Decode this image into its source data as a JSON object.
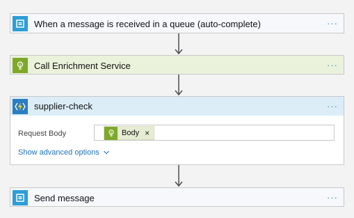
{
  "steps": [
    {
      "title": "When a message is received in a queue (auto-complete)",
      "more": "···",
      "icon": "service-bus-icon"
    },
    {
      "title": "Call Enrichment Service",
      "more": "···",
      "icon": "lightbulb-icon"
    },
    {
      "title": "supplier-check",
      "more": "···",
      "icon": "azure-function-icon",
      "fields": [
        {
          "label": "Request Body",
          "token": {
            "label": "Body",
            "remove": "×",
            "icon": "lightbulb-icon"
          }
        }
      ],
      "advanced_link": "Show advanced options"
    },
    {
      "title": "Send message",
      "more": "···",
      "icon": "service-bus-icon"
    }
  ],
  "colors": {
    "service_bus": "#2d9ed6",
    "enrichment": "#7fa82b",
    "function_header": "#dcedf7",
    "enrichment_header": "#eaf2dc",
    "link": "#1d73b9"
  }
}
